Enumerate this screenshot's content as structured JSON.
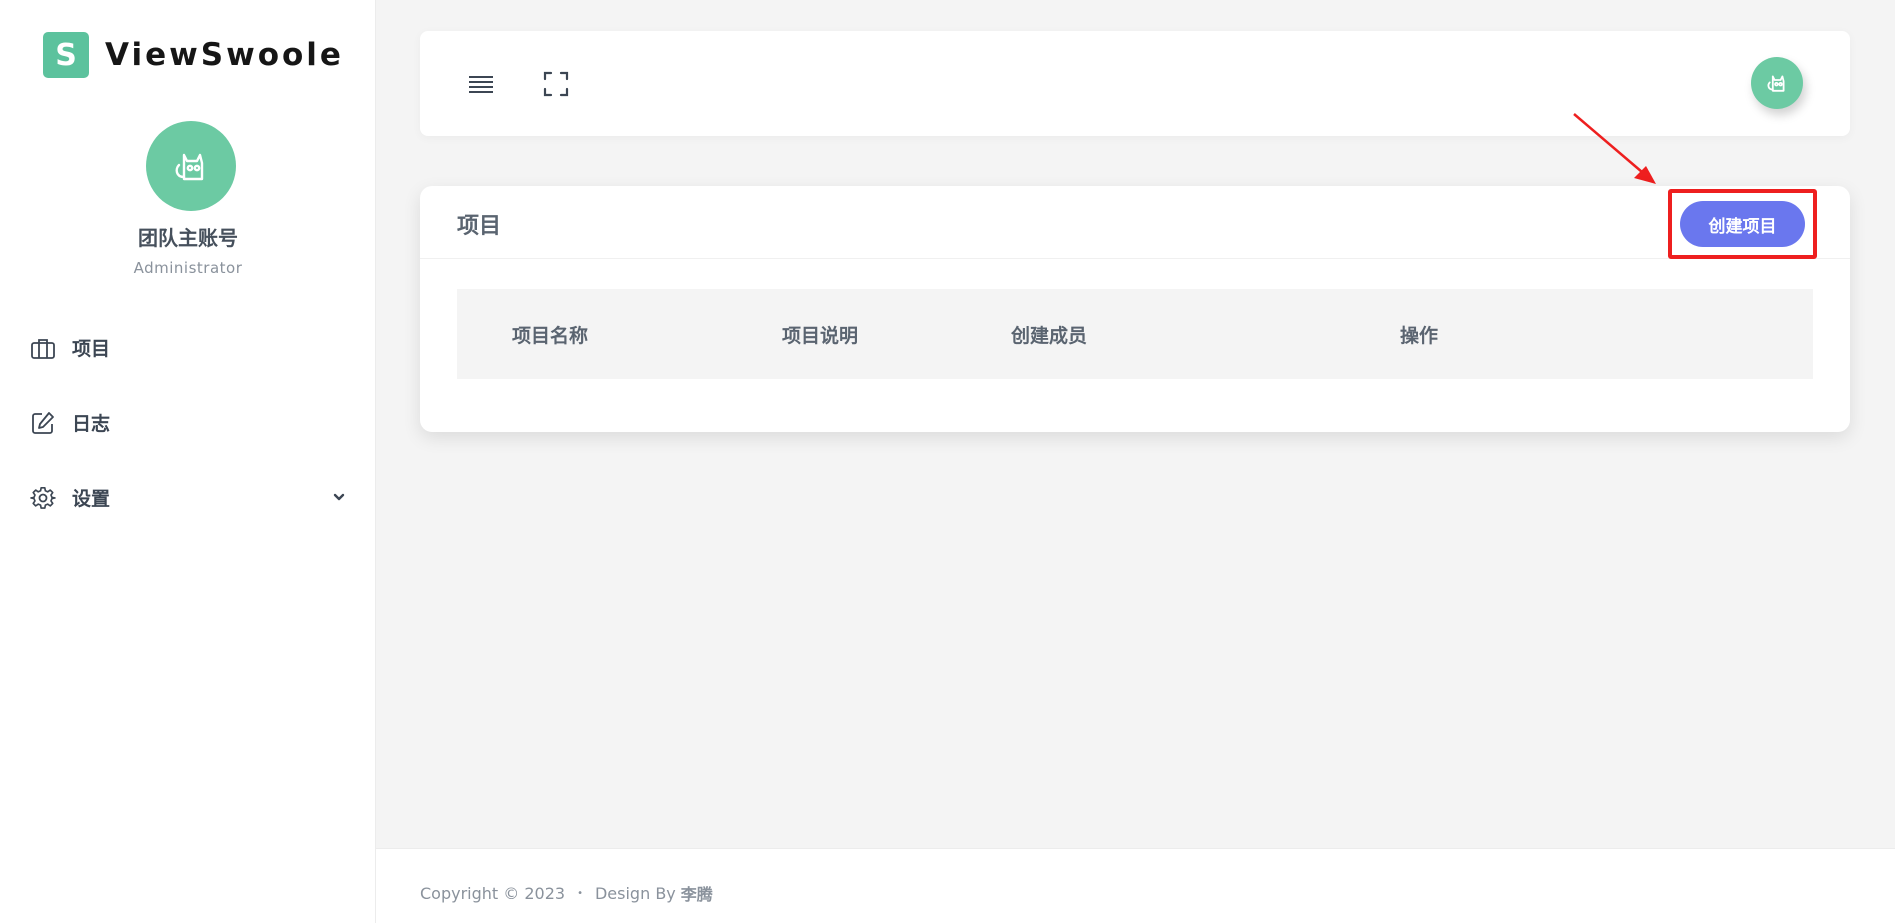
{
  "brand": {
    "logo_letter": "S",
    "name": "ViewSwoole",
    "color": "#5cc29d"
  },
  "profile": {
    "name": "团队主账号",
    "role": "Administrator",
    "avatar_icon": "cat-icon"
  },
  "sidebar": {
    "items": [
      {
        "label": "项目",
        "icon": "briefcase-icon"
      },
      {
        "label": "日志",
        "icon": "edit-icon"
      },
      {
        "label": "设置",
        "icon": "gear-icon",
        "has_submenu": true
      }
    ]
  },
  "topbar": {
    "menu_icon": "menu-icon",
    "fullscreen_icon": "fullscreen-icon",
    "avatar_icon": "cat-icon"
  },
  "main": {
    "title": "项目",
    "create_button": "创建项目",
    "columns": [
      "项目名称",
      "项目说明",
      "创建成员",
      "操作"
    ],
    "rows": []
  },
  "footer": {
    "copyright": "Copyright © 2023",
    "separator": "•",
    "design_by": "Design By",
    "author": "李腾"
  },
  "colors": {
    "accent": "#6a77ee",
    "avatar": "#6ccaa3",
    "highlight": "#ee1f1f"
  }
}
